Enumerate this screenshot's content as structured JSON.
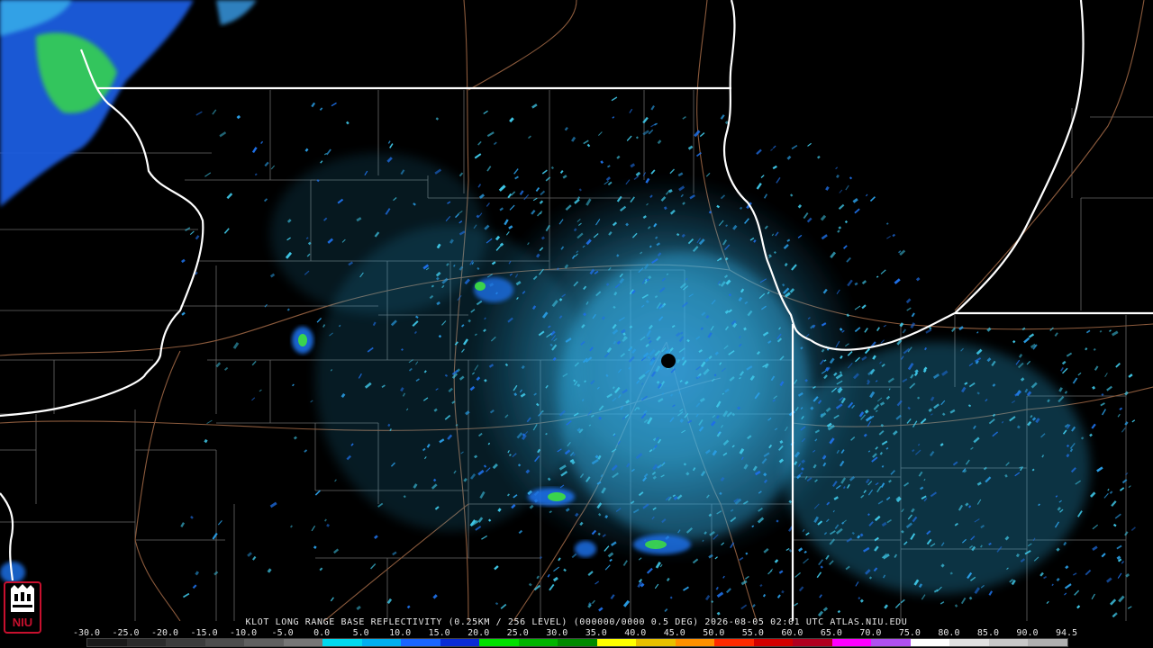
{
  "caption": "KLOT LONG RANGE BASE REFLECTIVITY (0.25KM / 256 LEVEL) (000000/0000 0.5 DEG) 2026-08-05 02:01 UTC  ATLAS.NIU.EDU",
  "colorbar": {
    "labels": [
      "-30.0",
      "-25.0",
      "-20.0",
      "-15.0",
      "-10.0",
      "-5.0",
      "0.0",
      "5.0",
      "10.0",
      "15.0",
      "20.0",
      "25.0",
      "30.0",
      "35.0",
      "40.0",
      "45.0",
      "50.0",
      "55.0",
      "60.0",
      "65.0",
      "70.0",
      "75.0",
      "80.0",
      "85.0",
      "90.0",
      "94.5"
    ],
    "colors": [
      "#1a1a1a",
      "#2b2b2b",
      "#3c3c3c",
      "#4d4d4d",
      "#606060",
      "#767676",
      "#00d9ee",
      "#00b0f0",
      "#1a66ff",
      "#0a2cd6",
      "#00e000",
      "#00b400",
      "#008a00",
      "#ffff00",
      "#e8c000",
      "#ff9000",
      "#ff2a00",
      "#d20000",
      "#b00020",
      "#ff00ff",
      "#b050f0",
      "#ffffff",
      "#e0e0e0",
      "#c8c8c8",
      "#b0b0b0"
    ]
  },
  "logo": {
    "text": "NIU",
    "color": "#c8102e"
  },
  "colors": {
    "state_border": "#ffffff",
    "county_border": "#8a8a8a",
    "road": "#8b5a3c",
    "echo_light": "#3fc8e8",
    "echo_mid": "#1e6fe6",
    "echo_strong": "#3ee03e"
  }
}
